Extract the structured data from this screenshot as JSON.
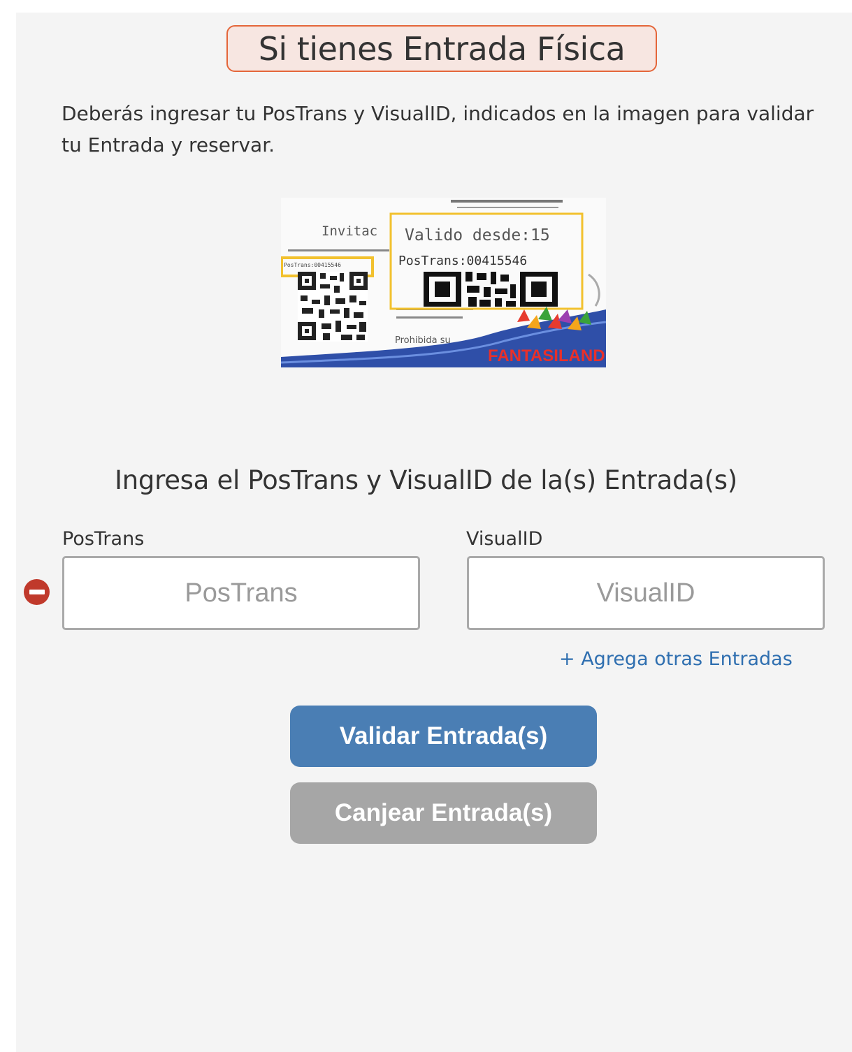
{
  "header": {
    "title": "Si tienes Entrada Física"
  },
  "intro": {
    "text": "Deberás ingresar tu PosTrans y VisualID, indicados en la imagen para validar tu Entrada y reservar."
  },
  "ticket_image": {
    "invitation_text": "Invitac",
    "valid_from": "Valido desde:15",
    "postrans_text": "PosTrans:00415546",
    "small_postrans": "PosTrans:00415546",
    "prohibited": "Prohibida su",
    "brand": "FANTASILANDIA",
    "highlight_color": "#f2c12e"
  },
  "form": {
    "subtitle": "Ingresa el PosTrans y VisualID de la(s) Entrada(s)",
    "postrans": {
      "label": "PosTrans",
      "placeholder": "PosTrans",
      "value": ""
    },
    "visualid": {
      "label": "VisualID",
      "placeholder": "VisualID",
      "value": ""
    },
    "remove_icon": "minus-circle-icon",
    "add_link": "+ Agrega otras Entradas"
  },
  "actions": {
    "validate_label": "Validar Entrada(s)",
    "redeem_label": "Canjear Entrada(s)"
  },
  "colors": {
    "title_border": "#e4663a",
    "link": "#2f6fb0",
    "validate_button": "#4a7eb4",
    "redeem_button": "#a6a6a6",
    "remove_icon": "#c0392b"
  }
}
